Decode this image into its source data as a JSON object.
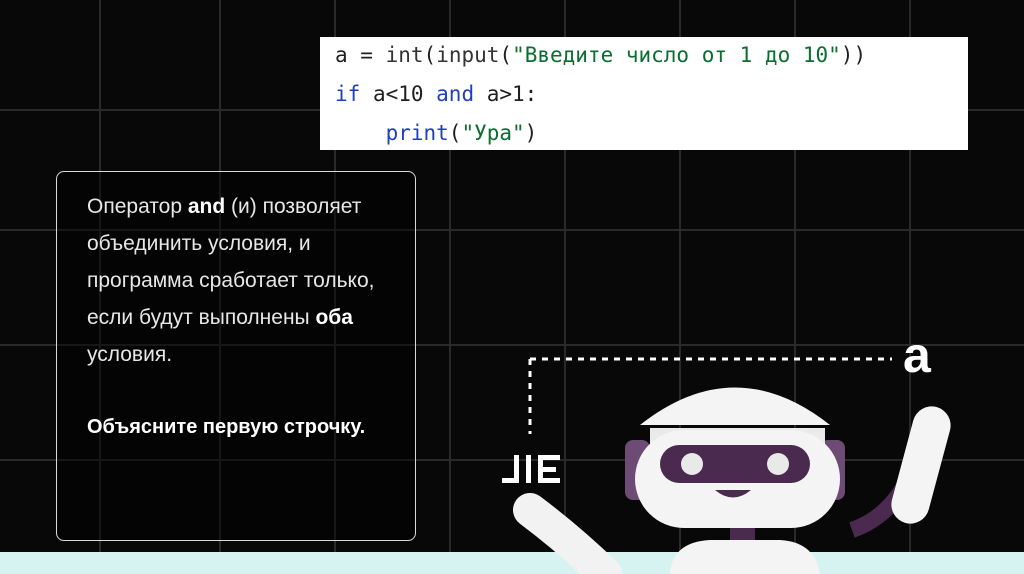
{
  "code": {
    "line1": {
      "var": "a",
      "eq": " = ",
      "int": "int",
      "p1": "(",
      "input": "input",
      "p2": "(",
      "str": "\"Введите число от 1 до 10\"",
      "p3": "))"
    },
    "line2": {
      "if": "if",
      "cond1": " a<10 ",
      "and": "and",
      "cond2": " a>1:"
    },
    "line3": {
      "indent": "    ",
      "print": "print",
      "p1": "(",
      "str": "\"Ура\"",
      "p2": ")"
    }
  },
  "info": {
    "t1": "Оператор ",
    "and": "and",
    "t2": " (и) позволяет объединить условия, и программа сработает только, если будут выполнены ",
    "both": "оба",
    "t3": " условия.",
    "question": "Объясните первую строчку."
  },
  "illustration": {
    "letter": "a",
    "logo": "ЈIE"
  },
  "colors": {
    "background": "#080808",
    "grid": "#2a2a2a",
    "robot_purple": "#4a2a4e",
    "strip": "#d6f3f2"
  },
  "icons": [
    "robot-illustration",
    "dashed-line",
    "logo-mark"
  ]
}
